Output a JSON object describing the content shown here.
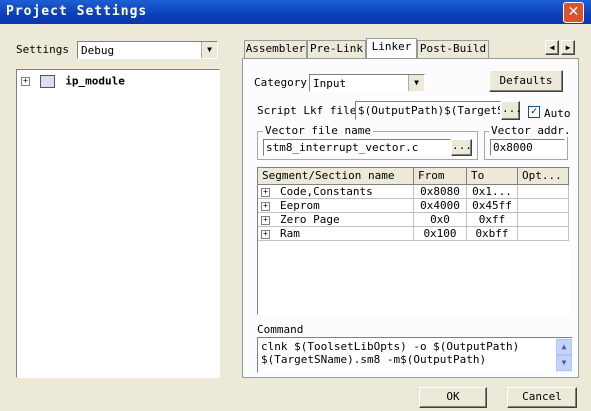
{
  "window": {
    "title": "Project Settings",
    "close_symbol": "✕"
  },
  "left": {
    "settings_label": "Settings",
    "settings_value": "Debug",
    "tree": [
      {
        "expander": "+",
        "label": "ip_module"
      }
    ]
  },
  "tabs": [
    {
      "label": "Assembler"
    },
    {
      "label": "Pre-Link"
    },
    {
      "label": "Linker"
    },
    {
      "label": "Post-Build"
    }
  ],
  "tab_scroll": {
    "left": "◀",
    "right": "▶"
  },
  "linker": {
    "category_label": "Category",
    "category_value": "Input",
    "defaults_label": "Defaults",
    "script_label": "Script Lkf file",
    "script_value": "$(OutputPath)$(TargetSN",
    "browse_label": "...",
    "auto_label": "Auto",
    "auto_checked": "✓",
    "vector_group_label": "Vector file name",
    "vector_value": "stm8_interrupt_vector.c",
    "vector_addr_label": "Vector addr.",
    "vector_addr_value": "0x8000"
  },
  "segments": {
    "headers": [
      "Segment/Section name",
      "From",
      "To",
      "Opt..."
    ],
    "rows": [
      {
        "name": "Code,Constants",
        "from": "0x8080",
        "to": "0x1...",
        "opt": ""
      },
      {
        "name": "Eeprom",
        "from": "0x4000",
        "to": "0x45ff",
        "opt": ""
      },
      {
        "name": "Zero Page",
        "from": "0x0",
        "to": "0xff",
        "opt": ""
      },
      {
        "name": "Ram",
        "from": "0x100",
        "to": "0xbff",
        "opt": ""
      }
    ]
  },
  "command": {
    "label": "Command",
    "line1": "clnk $(ToolsetLibOpts) -o $(OutputPath)",
    "line2": "$(TargetSName).sm8 -m$(OutputPath)"
  },
  "footer": {
    "ok_label": "OK",
    "cancel_label": "Cancel"
  }
}
